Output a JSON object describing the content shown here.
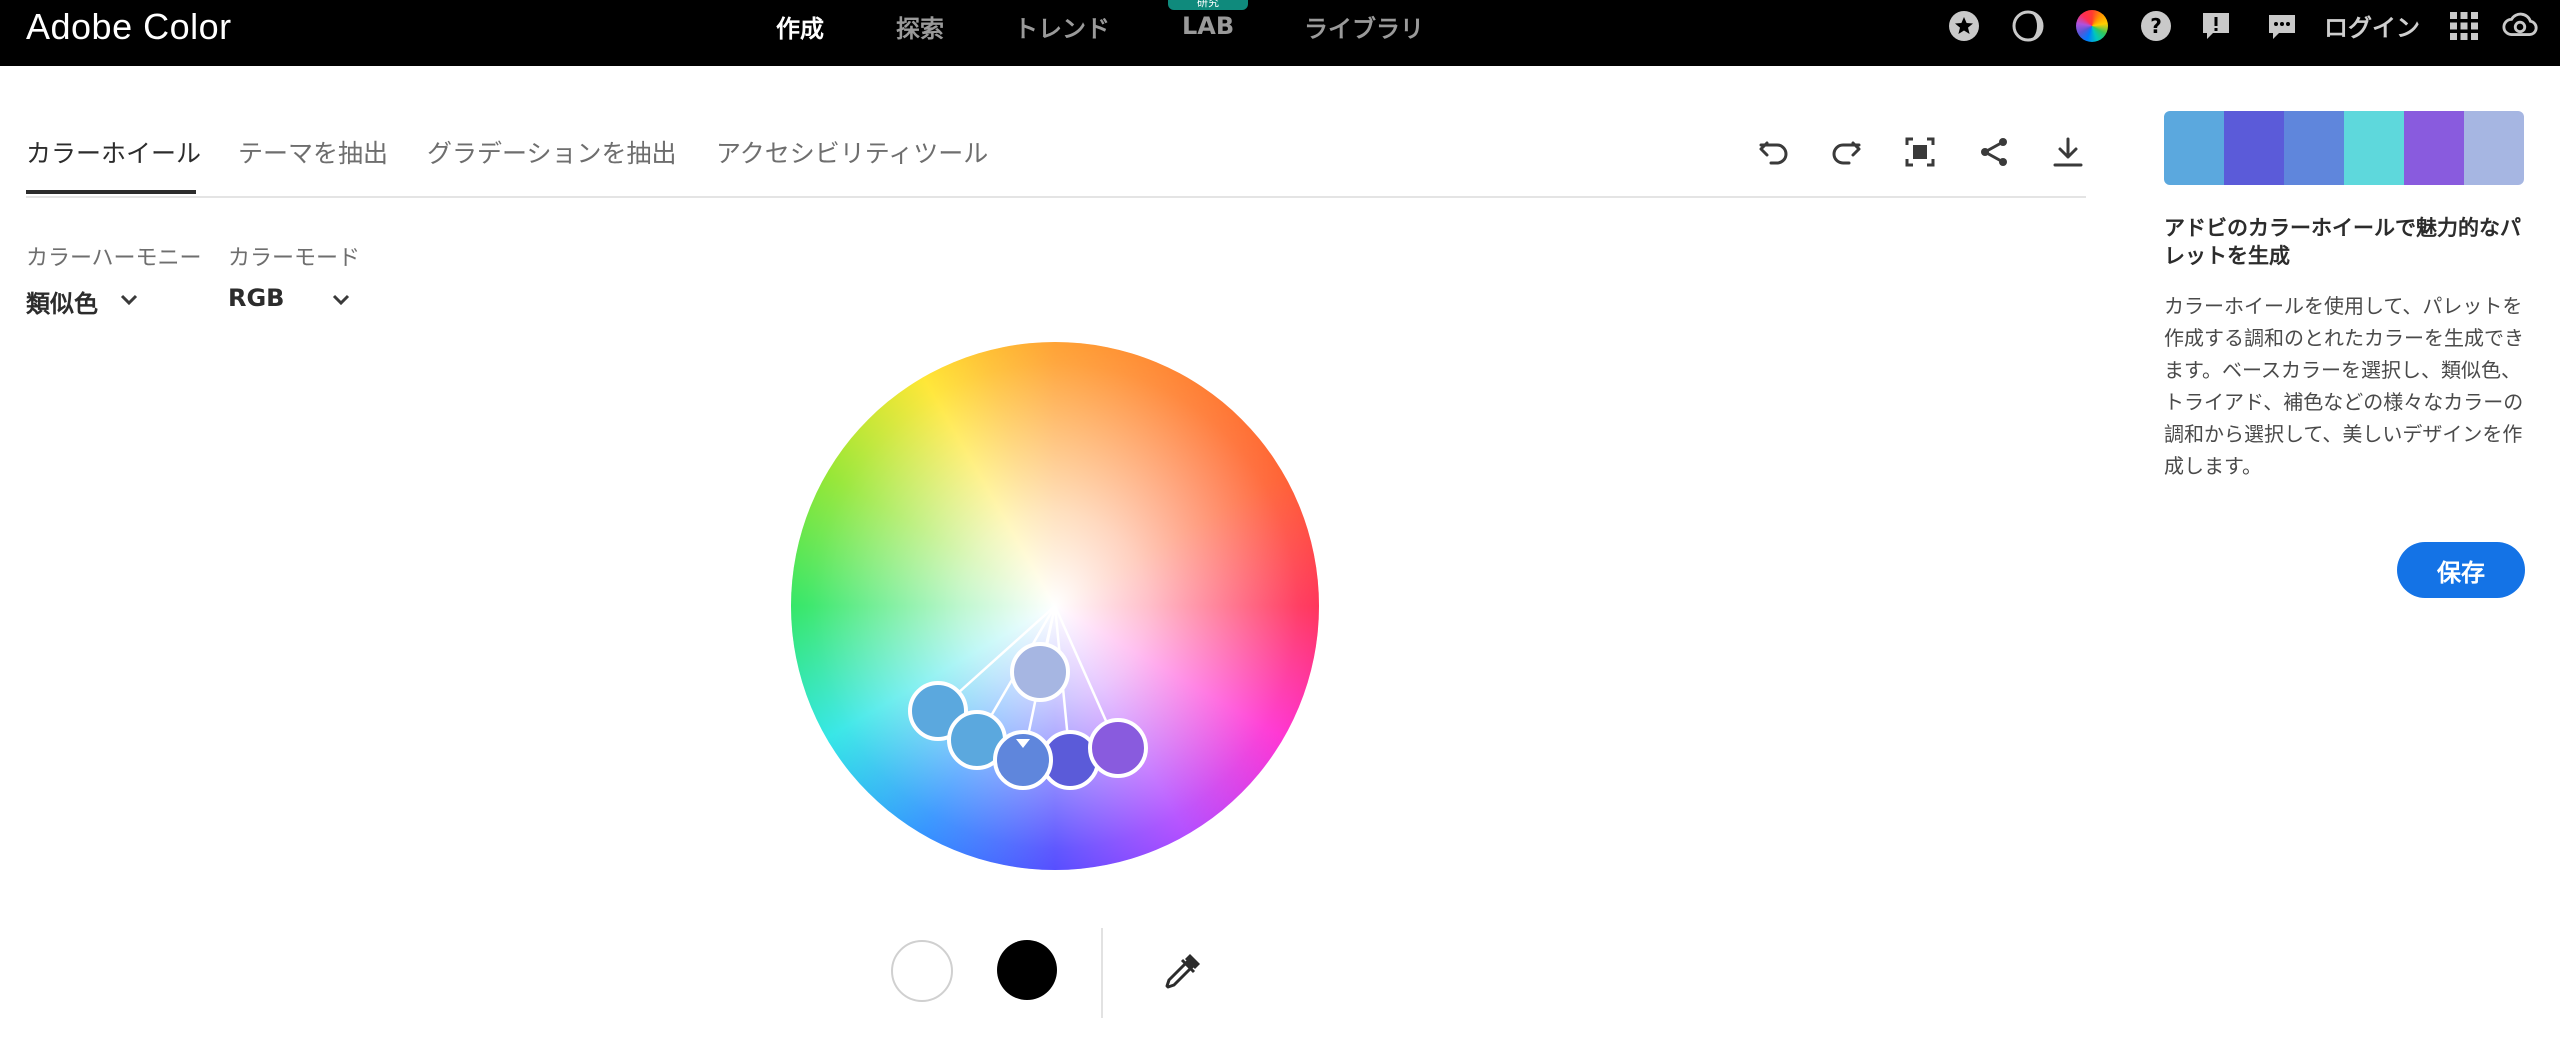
{
  "app": {
    "title": "Adobe Color"
  },
  "topnav": {
    "items": [
      {
        "label": "作成",
        "active": true
      },
      {
        "label": "探索",
        "active": false
      },
      {
        "label": "トレンド",
        "active": false
      },
      {
        "label": "LAB",
        "active": false,
        "badge": "研究"
      },
      {
        "label": "ライブラリ",
        "active": false
      }
    ],
    "icons": [
      "star-badge-icon",
      "contrast-icon",
      "color-wheel-icon",
      "help-icon",
      "feedback-alert-icon",
      "chat-icon"
    ],
    "login_label": "ログイン",
    "right_icons": [
      "app-grid-icon",
      "creative-cloud-icon"
    ]
  },
  "tabs": [
    {
      "label": "カラーホイール",
      "active": true
    },
    {
      "label": "テーマを抽出",
      "active": false
    },
    {
      "label": "グラデーションを抽出",
      "active": false
    },
    {
      "label": "アクセシビリティツール",
      "active": false
    }
  ],
  "toolbar": {
    "icons": [
      "undo-icon",
      "redo-icon",
      "fit-screen-icon",
      "share-icon",
      "download-icon"
    ]
  },
  "controls": {
    "harmony": {
      "label": "カラーハーモニー",
      "value": "類似色"
    },
    "mode": {
      "label": "カラーモード",
      "value": "RGB"
    }
  },
  "bottom_tools": {
    "icons": [
      "white-swatch",
      "black-swatch",
      "eyedropper-icon"
    ]
  },
  "palette": {
    "colors": [
      "#5BA8DE",
      "#5B5BD9",
      "#5F86DC",
      "#5ED8DC",
      "#895BDE",
      "#A6B6E2"
    ]
  },
  "side": {
    "title": "アドビのカラーホイールで魅力的なパレットを生成",
    "body": "カラーホイールを使用して、パレットを作成する調和のとれたカラーを生成できます。ベースカラーを選択し、類似色、トライアド、補色などの様々なカラーの調和から選択して、美しいデザインを作成します。",
    "save_label": "保存"
  }
}
